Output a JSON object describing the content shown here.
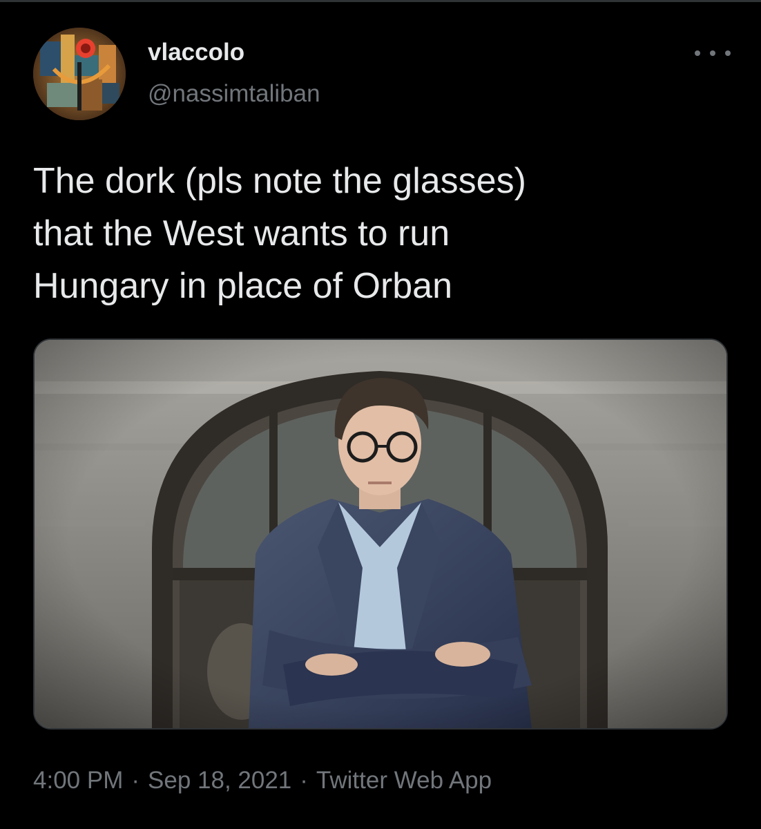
{
  "user": {
    "display_name": "vlaccolo",
    "handle": "@nassimtaliban"
  },
  "more_icon": "more-horizontal-icon",
  "tweet": {
    "text": "The dork (pls note the glasses)\nthat the West wants to run\nHungary in place of Orban"
  },
  "meta": {
    "time": "4:00 PM",
    "date": "Sep 18, 2021",
    "source": "Twitter Web App",
    "separator": "·"
  },
  "colors": {
    "background": "#000000",
    "text_primary": "#e7e9ea",
    "text_secondary": "#71767b",
    "border": "#2f3336"
  }
}
